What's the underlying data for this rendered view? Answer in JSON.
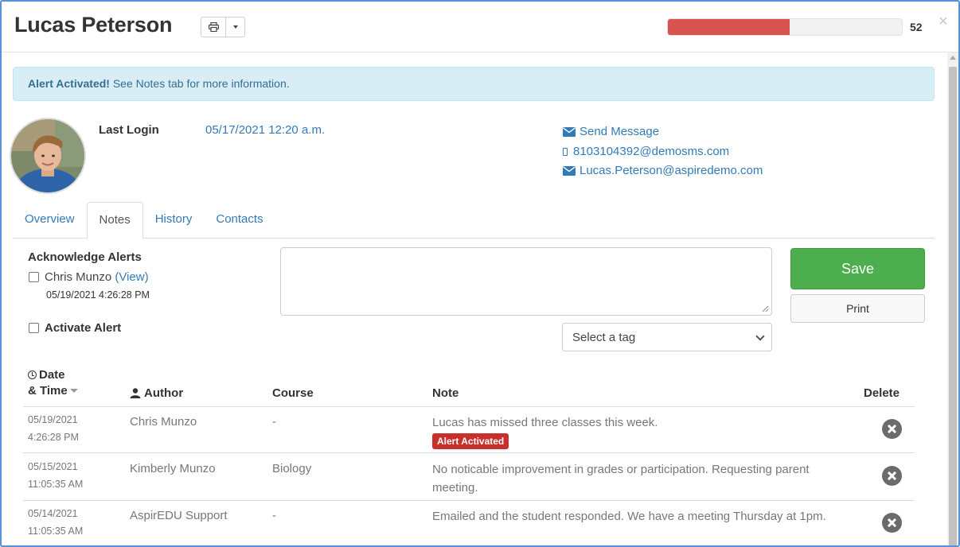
{
  "student": {
    "name": "Lucas Peterson",
    "progress_value": "52",
    "progress_fraction": 0.52
  },
  "alert": {
    "strong": "Alert Activated!",
    "text": " See Notes tab for more information."
  },
  "profile": {
    "last_login_label": "Last Login",
    "last_login_value": "05/17/2021 12:20 a.m.",
    "send_message": "Send Message",
    "sms": "8103104392@demosms.com",
    "email": "Lucas.Peterson@aspiredemo.com"
  },
  "tabs": [
    {
      "label": "Overview"
    },
    {
      "label": "Notes",
      "active": true
    },
    {
      "label": "History"
    },
    {
      "label": "Contacts"
    }
  ],
  "notes_form": {
    "ack_title": "Acknowledge Alerts",
    "ack_person": "Chris Munzo",
    "ack_view": "(View)",
    "ack_time": "05/19/2021 4:26:28 PM",
    "activate_label": "Activate Alert",
    "note_value": "",
    "tag_placeholder": "Select a tag",
    "save_label": "Save",
    "print_label": "Print"
  },
  "table": {
    "headers": {
      "date_line1": "Date",
      "date_line2": "& Time",
      "author": "Author",
      "course": "Course",
      "note": "Note",
      "delete": "Delete"
    },
    "rows": [
      {
        "date": "05/19/2021",
        "time": "4:26:28 PM",
        "author": "Chris Munzo",
        "course": "-",
        "note": "Lucas has missed three classes this week.",
        "badge": "Alert Activated"
      },
      {
        "date": "05/15/2021",
        "time": "11:05:35 AM",
        "author": "Kimberly Munzo",
        "course": "Biology",
        "note": "No noticable improvement in grades or participation. Requesting parent meeting.",
        "badge": ""
      },
      {
        "date": "05/14/2021",
        "time": "11:05:35 AM",
        "author": "AspirEDU Support",
        "course": "-",
        "note": "Emailed and the student responded. We have a meeting Thursday at 1pm.",
        "badge": ""
      }
    ]
  },
  "icons": {
    "print": "printer-icon",
    "dropdown": "caret-down-icon",
    "close": "close-icon",
    "mail": "envelope-icon",
    "phone": "mobile-phone-icon",
    "clock": "clock-icon",
    "user": "user-icon",
    "delete": "times-circle-icon"
  },
  "colors": {
    "link": "#337ab7",
    "alert_bg": "#d9edf7",
    "alert_text": "#31708f",
    "progress": "#d9534f",
    "save": "#4cae4c",
    "badge": "#c9302c"
  }
}
